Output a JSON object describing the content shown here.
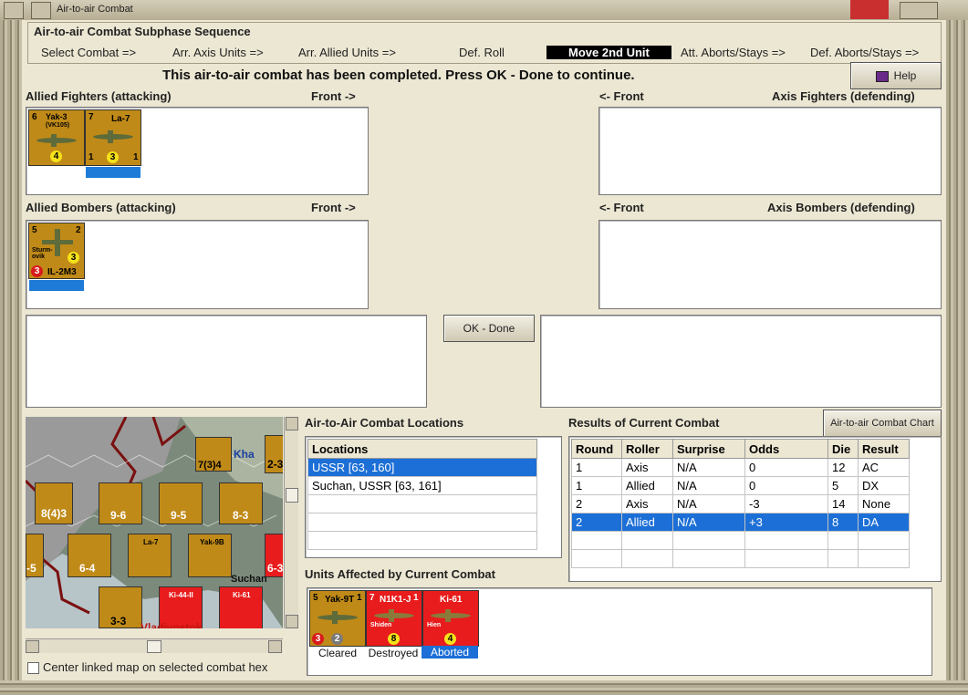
{
  "window": {
    "title": "Air-to-air Combat"
  },
  "subphase": {
    "group_label": "Air-to-air Combat Subphase Sequence",
    "steps": [
      "Select Combat =>",
      "Arr. Axis Units =>",
      "Arr. Allied Units =>",
      "Def. Roll",
      "Move 2nd Unit",
      "Att. Aborts/Stays =>",
      "Def. Aborts/Stays =>"
    ],
    "active_step": "Move 2nd Unit"
  },
  "message": "This air-to-air combat has been completed.  Press OK - Done to continue.",
  "buttons": {
    "help": "Help",
    "ok_done": "OK - Done",
    "chart": "Air-to-air Combat Chart"
  },
  "panels": {
    "allied_fighters": "Allied Fighters (attacking)",
    "axis_fighters": "Axis Fighters (defending)",
    "allied_bombers": "Allied Bombers (attacking)",
    "axis_bombers": "Axis Bombers (defending)",
    "front_right": "Front ->",
    "front_left": "<- Front"
  },
  "allied_fighter_units": [
    {
      "name": "Yak-3",
      "sub": "(VK105)",
      "top": "6",
      "circle": "4",
      "color": "#c08a18"
    },
    {
      "name": "La-7",
      "sub": "",
      "top": "7",
      "circle": "3",
      "bl": "1",
      "br": "1",
      "color": "#c08a18"
    }
  ],
  "allied_bomber_units": [
    {
      "name": "IL-2M3",
      "sub": "Sturm-ovik",
      "top": "5",
      "tr": "2",
      "circle": "3",
      "red": "3",
      "color": "#c08a18"
    }
  ],
  "locations": {
    "title": "Air-to-Air Combat Locations",
    "header": "Locations",
    "rows": [
      "USSR [63, 160]",
      "Suchan, USSR [63, 161]"
    ],
    "selected": 0
  },
  "results": {
    "title": "Results of Current Combat",
    "columns": [
      "Round",
      "Roller",
      "Surprise",
      "Odds",
      "Die",
      "Result"
    ],
    "rows": [
      [
        "1",
        "Axis",
        "N/A",
        "0",
        "12",
        "AC"
      ],
      [
        "1",
        "Allied",
        "N/A",
        "0",
        "5",
        "DX"
      ],
      [
        "2",
        "Axis",
        "N/A",
        "-3",
        "14",
        "None"
      ],
      [
        "2",
        "Allied",
        "N/A",
        "+3",
        "8",
        "DA"
      ]
    ],
    "selected": 3
  },
  "affected": {
    "title": "Units Affected by Current Combat",
    "units": [
      {
        "name": "Yak-9T",
        "top": "5",
        "tr": "1",
        "red": "3",
        "grey": "2",
        "status": "Cleared",
        "color": "#c08a18"
      },
      {
        "name": "N1K1-J",
        "top": "7",
        "tr": "1",
        "sub": "Shiden",
        "circle": "8",
        "status": "Destroyed",
        "color": "#e81c1c"
      },
      {
        "name": "Ki-61",
        "sub": "Hien",
        "circle": "4",
        "status": "Aborted",
        "color": "#e81c1c"
      }
    ]
  },
  "map": {
    "city_1": "Suchan",
    "city_2": "Vladivostok",
    "city_fragment": "Kha",
    "hex_labels": [
      "7(3)4",
      "8(4)3",
      "9-6",
      "9-5",
      "8-3",
      "6-4",
      "2-3",
      "6-3",
      "3-3",
      "-5"
    ],
    "air_units": [
      "La-7",
      "Yak-9B",
      "Ki-44-II",
      "Ki-61"
    ]
  },
  "checkbox": {
    "label": "Center linked map on selected combat hex",
    "checked": false
  }
}
